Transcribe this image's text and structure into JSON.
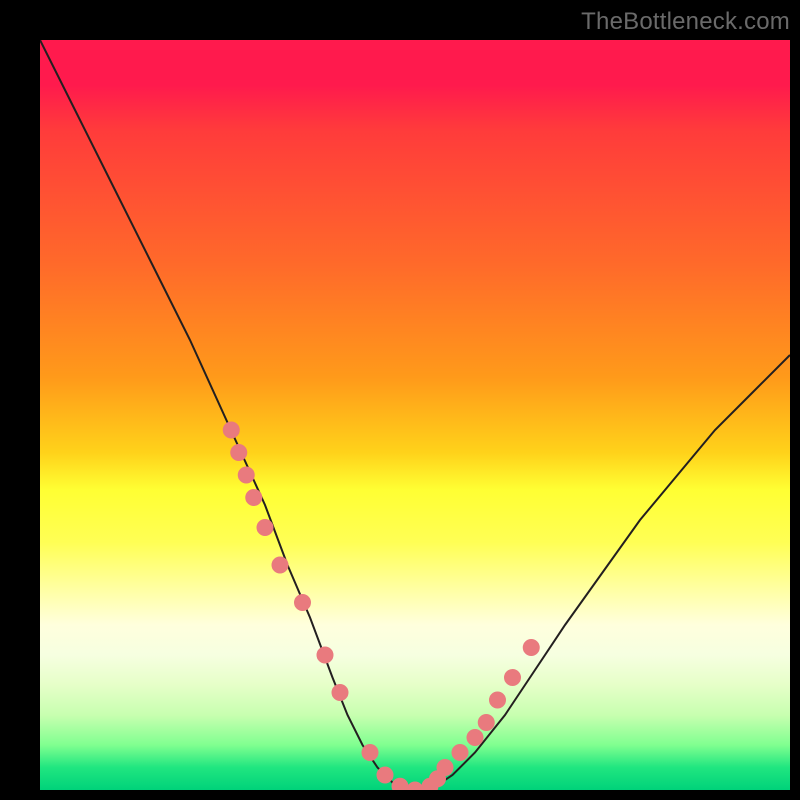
{
  "watermark": "TheBottleneck.com",
  "chart_data": {
    "type": "line",
    "title": "",
    "xlabel": "",
    "ylabel": "",
    "ylim": [
      0,
      100
    ],
    "xlim": [
      0,
      100
    ],
    "series": [
      {
        "name": "bottleneck-curve",
        "x": [
          0,
          5,
          10,
          15,
          20,
          25,
          30,
          33,
          36,
          39,
          41,
          43,
          45,
          47,
          49,
          50,
          52,
          55,
          58,
          62,
          66,
          70,
          75,
          80,
          85,
          90,
          95,
          100
        ],
        "values": [
          100,
          90,
          80,
          70,
          60,
          49,
          38,
          30,
          23,
          15,
          10,
          6,
          3,
          1,
          0,
          0,
          0,
          2,
          5,
          10,
          16,
          22,
          29,
          36,
          42,
          48,
          53,
          58
        ]
      }
    ],
    "markers": {
      "name": "highlighted-points",
      "x": [
        25.5,
        26.5,
        27.5,
        28.5,
        30,
        32,
        35,
        38,
        40,
        44,
        46,
        48,
        50,
        52,
        53,
        54,
        56,
        58,
        59.5,
        61,
        63,
        65.5
      ],
      "values": [
        48,
        45,
        42,
        39,
        35,
        30,
        25,
        18,
        13,
        5,
        2,
        0.5,
        0,
        0.5,
        1.5,
        3,
        5,
        7,
        9,
        12,
        15,
        19
      ]
    },
    "marker_radius_px": 8,
    "background_gradient": {
      "top_color": "#ff1a4d",
      "mid_colors": [
        "#ff9a1a",
        "#ffff33",
        "#ffffdd"
      ],
      "bottom_color": "#00d27a"
    },
    "curve_color": "#231f20",
    "marker_color": "#e97a7e"
  }
}
